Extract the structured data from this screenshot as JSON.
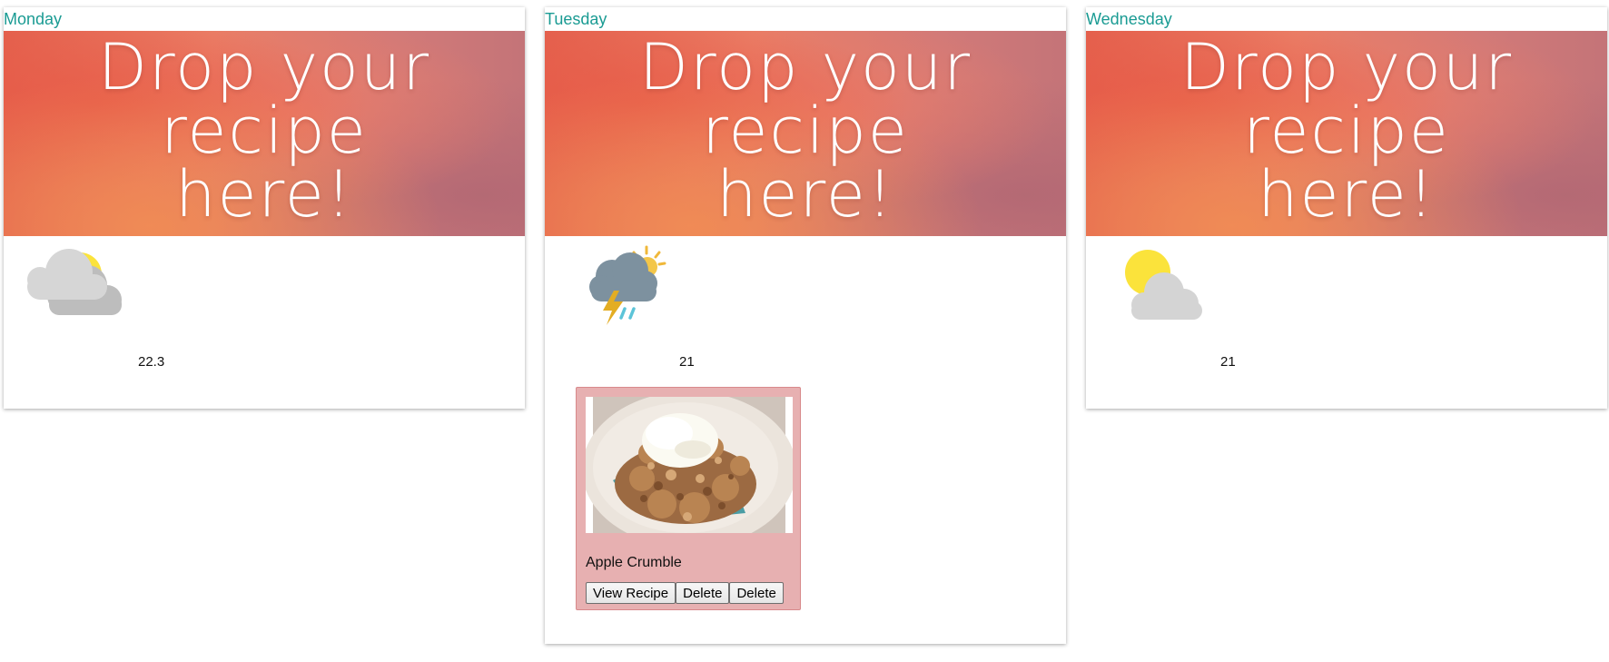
{
  "days": [
    {
      "name": "Monday",
      "drop_text": "Drop your recipe here!",
      "weather_icon": "partly-cloudy-icon",
      "temperature": "22.3"
    },
    {
      "name": "Tuesday",
      "drop_text": "Drop your recipe here!",
      "weather_icon": "thunderstorm-sun-icon",
      "temperature": "21",
      "recipe": {
        "name": "Apple Crumble",
        "buttons": [
          "View Recipe",
          "Delete",
          "Delete"
        ]
      }
    },
    {
      "name": "Wednesday",
      "drop_text": "Drop your recipe here!",
      "weather_icon": "sun-behind-cloud-icon",
      "temperature": "21"
    }
  ],
  "colors": {
    "day_title": "#1a9b93",
    "recipe_card_bg": "#e7b0b1",
    "banner_text": "#ffffff"
  }
}
